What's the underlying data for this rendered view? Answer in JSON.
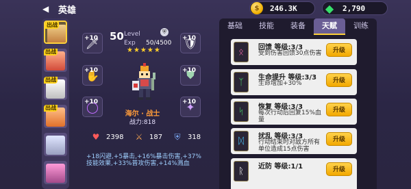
{
  "header": {
    "back_icon": "back-arrow-icon",
    "title": "英雄",
    "coins": "246.3K",
    "gems": "2,790",
    "coin_icon": "gold-coin-icon",
    "gem_icon": "green-gem-icon"
  },
  "hero_list": {
    "items": [
      {
        "tag": "出战",
        "selected": true,
        "color": "#c07a3a"
      },
      {
        "tag": "出战",
        "selected": false,
        "color": "#d24a3a"
      },
      {
        "tag": "出战",
        "selected": false,
        "color": "#bfbfbf"
      },
      {
        "tag": "出战",
        "selected": false,
        "color": "#e0702a"
      },
      {
        "tag": "",
        "selected": false,
        "color": "#9aa0c0"
      },
      {
        "tag": "",
        "selected": false,
        "color": "#a34a8a"
      }
    ]
  },
  "hero": {
    "level": "50",
    "level_label": "Level",
    "exp_label": "Exp",
    "exp_value": "50/4500",
    "stars": "★★★★★",
    "name": "海尔 · 战士",
    "power": "战力:818",
    "equip": [
      {
        "plus": "+10",
        "icon": "sword-icon"
      },
      {
        "plus": "+10",
        "icon": "shield-icon"
      },
      {
        "plus": "+10",
        "icon": "gauntlet-icon"
      },
      {
        "plus": "+10",
        "icon": "armor-icon"
      },
      {
        "plus": "+10",
        "icon": "ring-icon"
      },
      {
        "plus": "+10",
        "icon": "amulet-icon"
      }
    ],
    "stats": [
      {
        "icon": "heart-icon",
        "value": "2398",
        "color": "#ff5a5a"
      },
      {
        "icon": "sword-icon",
        "value": "187",
        "color": "#f0a050"
      },
      {
        "icon": "shield-icon",
        "value": "318",
        "color": "#7fb0ff"
      }
    ],
    "bonus_text": "+18闪避,+5暴击,+16%暴击伤害,+37%技能效果,+33%普攻伤害,+14%溅血"
  },
  "tabs": {
    "items": [
      "基础",
      "技能",
      "装备",
      "天赋",
      "训练"
    ],
    "active": "天赋"
  },
  "talents": [
    {
      "name": "回馈 等级:3/3",
      "desc": "受到伤害回馈30点伤害",
      "button": "升级",
      "icon": "rune-icon",
      "color": "#ff6bb0"
    },
    {
      "name": "生命提升 等级:3/3",
      "desc": "生命增加+30%",
      "button": "升级",
      "icon": "rune-icon",
      "color": "#49d46a"
    },
    {
      "name": "恢复 等级:3/3",
      "desc": "每次行动后回复15%血量",
      "button": "升级",
      "icon": "rune-icon",
      "color": "#49d46a"
    },
    {
      "name": "扰乱 等级:3/3",
      "desc": "行动结束时对敌方所有单位造成15点伤害",
      "button": "升级",
      "icon": "rune-icon",
      "color": "#49c9ff"
    },
    {
      "name": "近防 等级:1/1",
      "desc": "",
      "button": "升级",
      "icon": "rune-icon",
      "color": "#ffffff"
    }
  ]
}
